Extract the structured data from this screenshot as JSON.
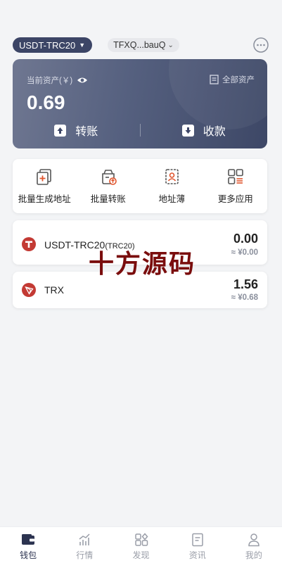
{
  "header": {
    "chain": "USDT-TRC20",
    "address": "TFXQ...bauQ"
  },
  "asset_card": {
    "label": "当前资产(￥)",
    "all_assets": "全部资产",
    "balance": "0.69",
    "transfer": "转账",
    "receive": "收款"
  },
  "tools": [
    {
      "label": "批量生成地址"
    },
    {
      "label": "批量转账"
    },
    {
      "label": "地址薄"
    },
    {
      "label": "更多应用"
    }
  ],
  "tokens": [
    {
      "name": "USDT-TRC20",
      "sub": "(TRC20)",
      "amount": "0.00",
      "fiat": "≈ ¥0.00"
    },
    {
      "name": "TRX",
      "sub": "",
      "amount": "1.56",
      "fiat": "≈ ¥0.68"
    }
  ],
  "watermark": "十方源码",
  "nav": [
    {
      "label": "钱包",
      "icon": "wallet-icon",
      "active": true
    },
    {
      "label": "行情",
      "icon": "chart-icon",
      "active": false
    },
    {
      "label": "发现",
      "icon": "discover-icon",
      "active": false
    },
    {
      "label": "资讯",
      "icon": "news-icon",
      "active": false
    },
    {
      "label": "我的",
      "icon": "profile-icon",
      "active": false
    }
  ],
  "colors": {
    "accent": "#3c4566",
    "token_red": "#c33a34"
  }
}
